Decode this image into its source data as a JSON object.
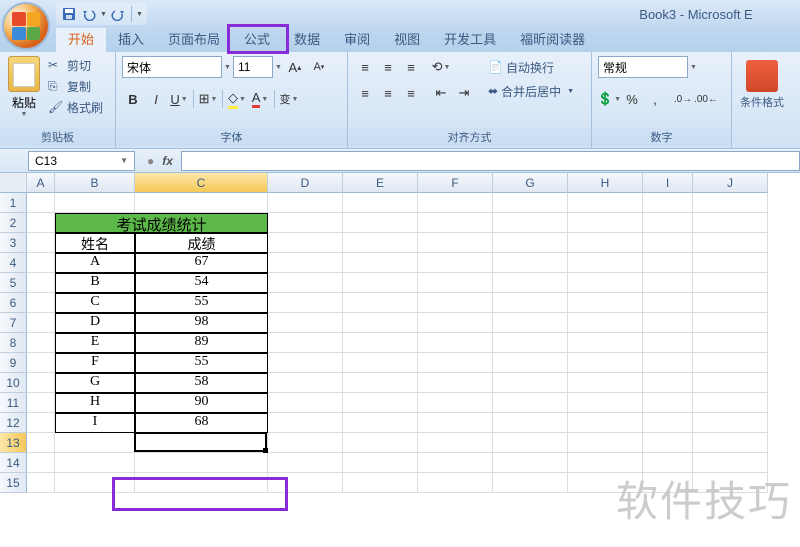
{
  "title": "Book3 - Microsoft E",
  "tabs": [
    "开始",
    "插入",
    "页面布局",
    "公式",
    "数据",
    "审阅",
    "视图",
    "开发工具",
    "福昕阅读器"
  ],
  "activeTab": 0,
  "highlightedTab": 3,
  "ribbon": {
    "clipboard": {
      "label": "剪贴板",
      "paste": "粘贴",
      "cut": "剪切",
      "copy": "复制",
      "format": "格式刷"
    },
    "font": {
      "label": "字体",
      "name": "宋体",
      "size": "11"
    },
    "align": {
      "label": "对齐方式",
      "wrap": "自动换行",
      "merge": "合并后居中"
    },
    "number": {
      "label": "数字",
      "format": "常规"
    },
    "cond": {
      "label": "条件格式"
    }
  },
  "namebox": "C13",
  "colWidths": {
    "A": 28,
    "B": 80,
    "C": 133,
    "D": 75,
    "E": 75,
    "F": 75,
    "G": 75,
    "H": 75,
    "I": 50,
    "J": 75
  },
  "columns": [
    "A",
    "B",
    "C",
    "D",
    "E",
    "F",
    "G",
    "H",
    "I",
    "J"
  ],
  "selectedCol": "C",
  "selectedRow": 13,
  "rowCount": 15,
  "table": {
    "title": "考试成绩统计",
    "h1": "姓名",
    "h2": "成绩",
    "rows": [
      {
        "n": "A",
        "s": "67"
      },
      {
        "n": "B",
        "s": "54"
      },
      {
        "n": "C",
        "s": "55"
      },
      {
        "n": "D",
        "s": "98"
      },
      {
        "n": "E",
        "s": "89"
      },
      {
        "n": "F",
        "s": "55"
      },
      {
        "n": "G",
        "s": "58"
      },
      {
        "n": "H",
        "s": "90"
      },
      {
        "n": "I",
        "s": "68"
      }
    ]
  },
  "watermark": "软件技巧",
  "chart_data": {
    "type": "table",
    "title": "考试成绩统计",
    "columns": [
      "姓名",
      "成绩"
    ],
    "rows": [
      [
        "A",
        67
      ],
      [
        "B",
        54
      ],
      [
        "C",
        55
      ],
      [
        "D",
        98
      ],
      [
        "E",
        89
      ],
      [
        "F",
        55
      ],
      [
        "G",
        58
      ],
      [
        "H",
        90
      ],
      [
        "I",
        68
      ]
    ]
  }
}
